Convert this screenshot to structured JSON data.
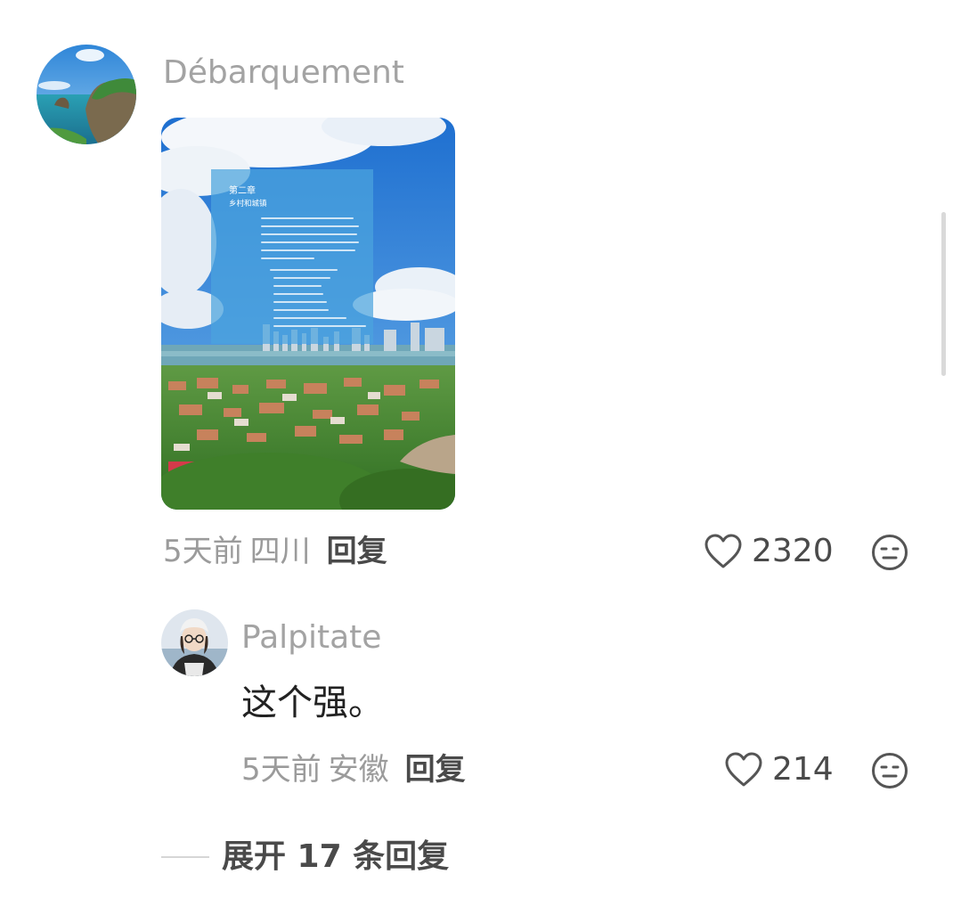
{
  "comment": {
    "username": "Débarquement",
    "image_text": {
      "title": "第二章",
      "subtitle": "乡村和城镇"
    },
    "time": "5天前",
    "location": "四川",
    "reply_label": "回复",
    "likes": "2320"
  },
  "reply": {
    "username": "Palpitate",
    "text": "这个强。",
    "time": "5天前",
    "location": "安徽",
    "reply_label": "回复",
    "likes": "214"
  },
  "expand_label": "展开 17 条回复",
  "icons": {
    "like": "heart-outline-icon",
    "dislike": "neutral-face-icon"
  },
  "colors": {
    "username": "#a3a3a3",
    "meta": "#9b9b9b",
    "reply_link": "#4a4a4a",
    "body_text": "#222222"
  }
}
